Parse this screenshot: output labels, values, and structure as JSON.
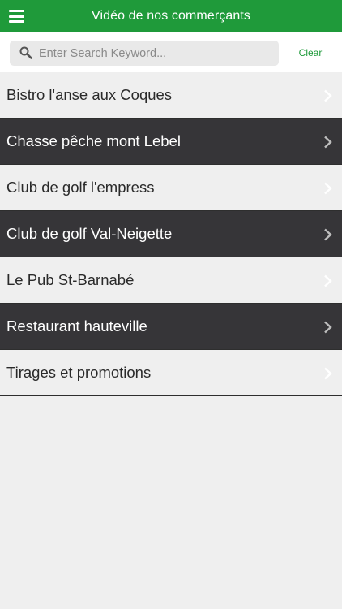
{
  "header": {
    "title": "Vidéo de nos commerçants",
    "menu_icon": "hamburger-menu-icon",
    "background_color": "#1f9a3a"
  },
  "search": {
    "placeholder": "Enter Search Keyword...",
    "value": "",
    "icon": "search-icon",
    "clear_label": "Clear"
  },
  "list": {
    "items": [
      {
        "label": "Bistro l'anse aux Coques",
        "style": "light"
      },
      {
        "label": "Chasse pêche mont Lebel",
        "style": "dark"
      },
      {
        "label": "Club de golf l'empress",
        "style": "light"
      },
      {
        "label": "Club de golf Val-Neigette",
        "style": "dark"
      },
      {
        "label": "Le Pub St-Barnabé",
        "style": "light"
      },
      {
        "label": "Restaurant hauteville",
        "style": "dark"
      },
      {
        "label": "Tirages et promotions",
        "style": "light"
      }
    ],
    "item_icon": "chevron-right-icon",
    "light_color": "#efefef",
    "dark_color": "#363538"
  }
}
